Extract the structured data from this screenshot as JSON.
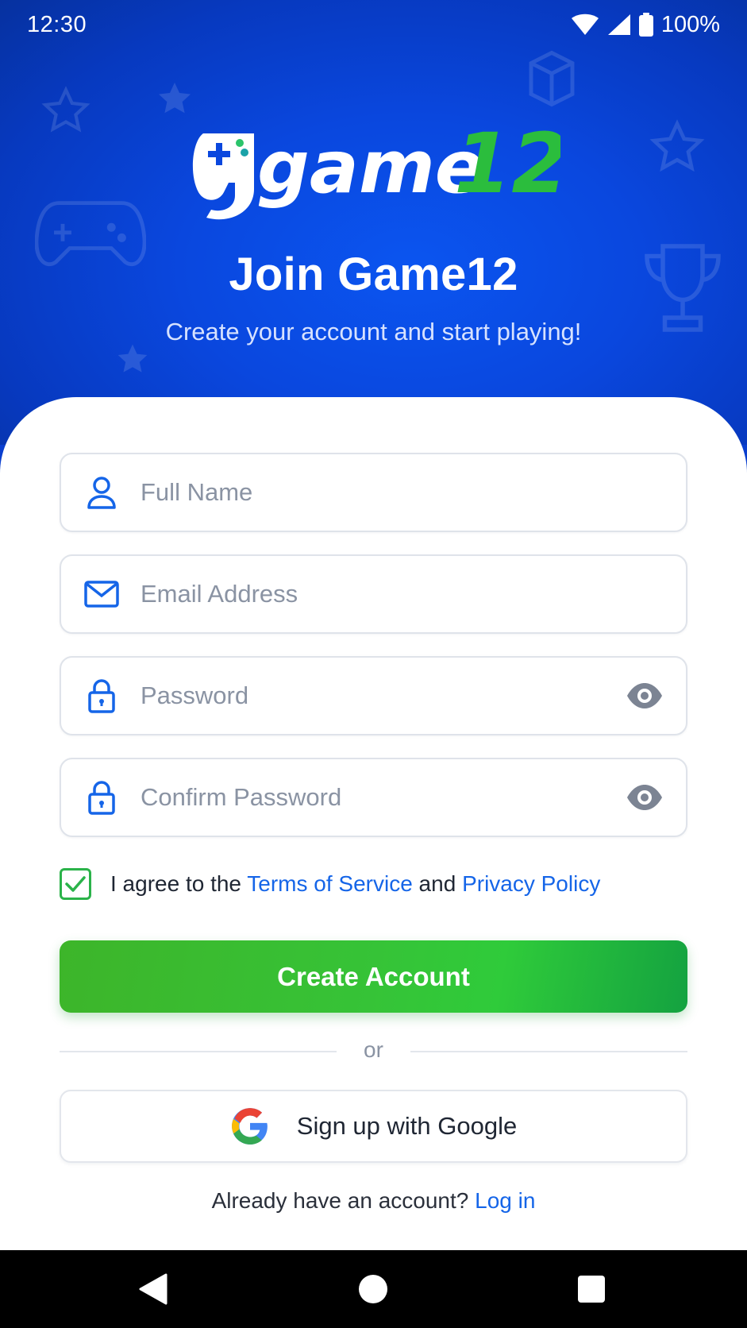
{
  "status_bar": {
    "time": "12:30",
    "battery": "100%"
  },
  "brand": {
    "logo_text": "game",
    "logo_number": "12",
    "primary_color": "#0a47de",
    "accent_green": "#2fcb3a"
  },
  "header": {
    "title": "Join Game12",
    "subtitle": "Create your account and start playing!"
  },
  "form": {
    "full_name": {
      "placeholder": "Full Name",
      "icon": "user-icon"
    },
    "email": {
      "placeholder": "Email Address",
      "icon": "mail-icon"
    },
    "password": {
      "placeholder": "Password",
      "icon": "lock-icon",
      "toggle_icon": "eye-icon"
    },
    "confirm_password": {
      "placeholder": "Confirm Password",
      "icon": "lock-icon",
      "toggle_icon": "eye-icon"
    },
    "agree": {
      "checked": true,
      "prefix": "I agree to the ",
      "terms_link": "Terms of Service",
      "middle": " and ",
      "privacy_link": "Privacy Policy"
    },
    "submit_label": "Create Account"
  },
  "divider_text": "or",
  "google": {
    "label": "Sign up with Google",
    "icon": "google-icon"
  },
  "login": {
    "prompt": "Already have an account? ",
    "link": "Log in"
  },
  "nav": {
    "back": "back-icon",
    "home": "home-icon",
    "recents": "recents-icon"
  }
}
